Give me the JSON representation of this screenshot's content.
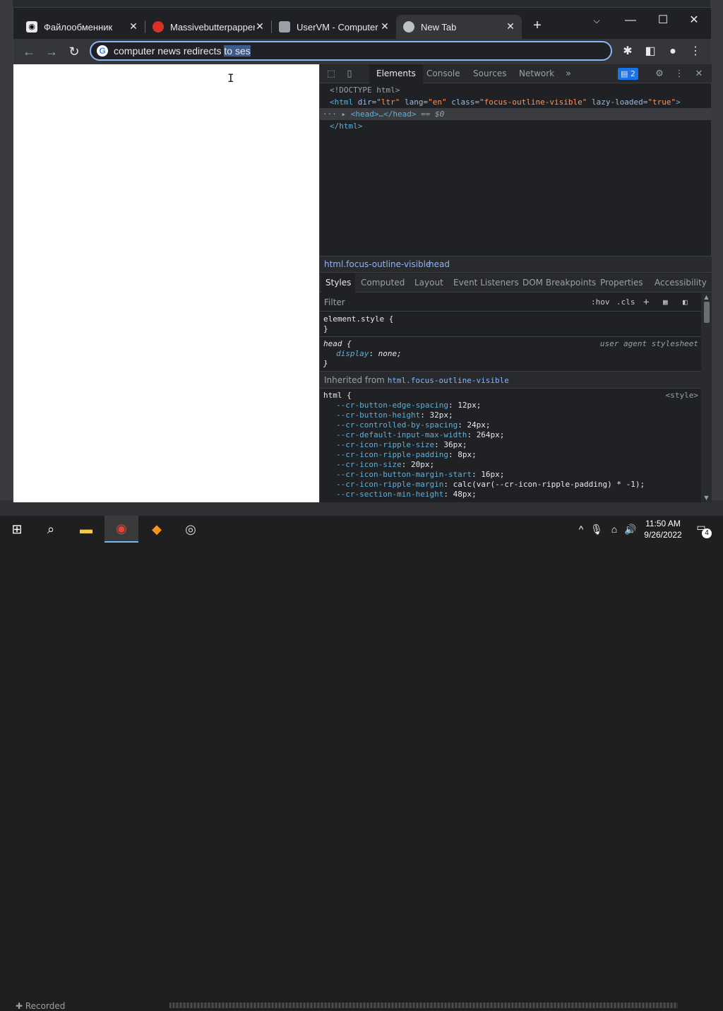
{
  "tabs": [
    {
      "title": "Файлообменник"
    },
    {
      "title": "Massivebutterpapper"
    },
    {
      "title": "UserVM - Computer"
    },
    {
      "title": "New Tab"
    }
  ],
  "omnibox": {
    "typed": "computer news redirects ",
    "selected": "to ses"
  },
  "devtools": {
    "tabs": [
      "Elements",
      "Console",
      "Sources",
      "Network"
    ],
    "more": "»",
    "issues_count": "2",
    "dom": {
      "doctype": "<!DOCTYPE html>",
      "html_open_tag": "<html",
      "attr_dir": "dir=",
      "val_dir": "\"ltr\"",
      "attr_lang": "lang=",
      "val_lang": "\"en\"",
      "attr_class": "class=",
      "val_class": "\"focus-outline-visible\"",
      "attr_lazy": "lazy-loaded=",
      "val_lazy": "\"true\"",
      "close_angle": ">",
      "head_collapsed": "<head>…</head>",
      "selected_marker": "== $0",
      "html_close": "</html>"
    },
    "breadcrumbs": [
      "html.focus-outline-visible",
      "head"
    ],
    "style_tabs": [
      "Styles",
      "Computed",
      "Layout",
      "Event Listeners",
      "DOM Breakpoints",
      "Properties",
      "Accessibility"
    ],
    "filter_placeholder": "Filter",
    "filter_hov": ":hov",
    "filter_cls": ".cls",
    "element_style_open": "element.style {",
    "rule_close": "}",
    "head_selector": "head {",
    "head_source": "user agent stylesheet",
    "head_prop": "display",
    "head_val": "none;",
    "inherited_label": "Inherited from",
    "inherited_link": "html.focus-outline-visible",
    "html_selector": "html {",
    "html_source": "<style>",
    "html_props": [
      {
        "name": "--cr-button-edge-spacing",
        "value": "12px;"
      },
      {
        "name": "--cr-button-height",
        "value": "32px;"
      },
      {
        "name": "--cr-controlled-by-spacing",
        "value": "24px;"
      },
      {
        "name": "--cr-default-input-max-width",
        "value": "264px;"
      },
      {
        "name": "--cr-icon-ripple-size",
        "value": "36px;"
      },
      {
        "name": "--cr-icon-ripple-padding",
        "value": "8px;"
      },
      {
        "name": "--cr-icon-size",
        "value": "20px;"
      },
      {
        "name": "--cr-icon-button-margin-start",
        "value": "16px;"
      },
      {
        "name": "--cr-icon-ripple-margin",
        "value": "calc(var(--cr-icon-ripple-padding) * -1);"
      },
      {
        "name": "--cr-section-min-height",
        "value": "48px;"
      }
    ]
  },
  "desktop": {
    "recorded_label": "Recorded"
  },
  "taskbar": {
    "time": "11:50 AM",
    "date": "9/26/2022",
    "notifications": "4"
  },
  "colors": {
    "accent": "#8ab4f8",
    "tab_active": "#35363a",
    "background": "#202124"
  }
}
